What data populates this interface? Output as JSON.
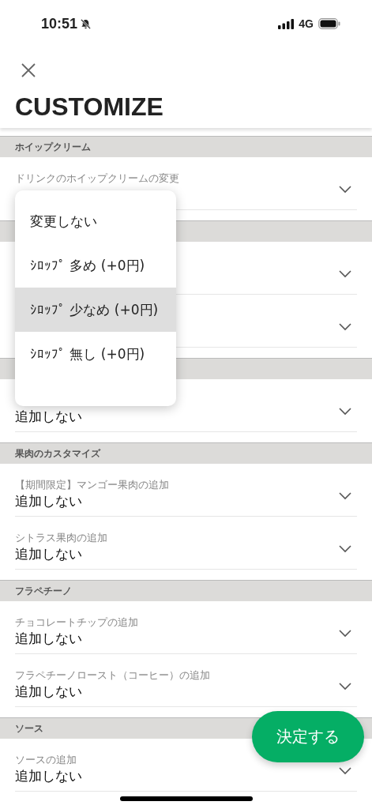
{
  "status_bar": {
    "time": "10:51",
    "network": "4G"
  },
  "header": {
    "title": "CUSTOMIZE"
  },
  "sections": [
    {
      "title": "ホイップクリーム",
      "rows": [
        {
          "kind": "select",
          "label": "ドリンクのホイップクリームの変更"
        }
      ]
    },
    {
      "rows": [
        {
          "kind": "select"
        },
        {
          "kind": "select"
        }
      ]
    },
    {
      "rows": [
        {
          "kind": "select",
          "value": "追加しない"
        }
      ]
    },
    {
      "title": "果肉のカスタマイズ",
      "rows": [
        {
          "kind": "select",
          "label": "【期間限定】マンゴー果肉の追加",
          "value": "追加しない"
        },
        {
          "kind": "select",
          "label": "シトラス果肉の追加",
          "value": "追加しない"
        }
      ]
    },
    {
      "title": "フラペチーノ",
      "rows": [
        {
          "kind": "select",
          "label": "チョコレートチップの追加",
          "value": "追加しない"
        },
        {
          "kind": "select",
          "label": "フラペチーノロースト（コーヒー）の追加",
          "value": "追加しない"
        }
      ]
    },
    {
      "title": "ソース",
      "rows": [
        {
          "kind": "select",
          "label": "ソースの追加",
          "value": "追加しない"
        }
      ]
    }
  ],
  "dropdown": {
    "options": [
      {
        "label": "変更しない",
        "selected": false
      },
      {
        "label": "ｼﾛｯﾌﾟ 多め (+0円)",
        "selected": false
      },
      {
        "label": "ｼﾛｯﾌﾟ 少なめ (+0円)",
        "selected": true
      },
      {
        "label": "ｼﾛｯﾌﾟ 無し (+0円)",
        "selected": false
      }
    ]
  },
  "submit_button": {
    "label": "決定する"
  }
}
